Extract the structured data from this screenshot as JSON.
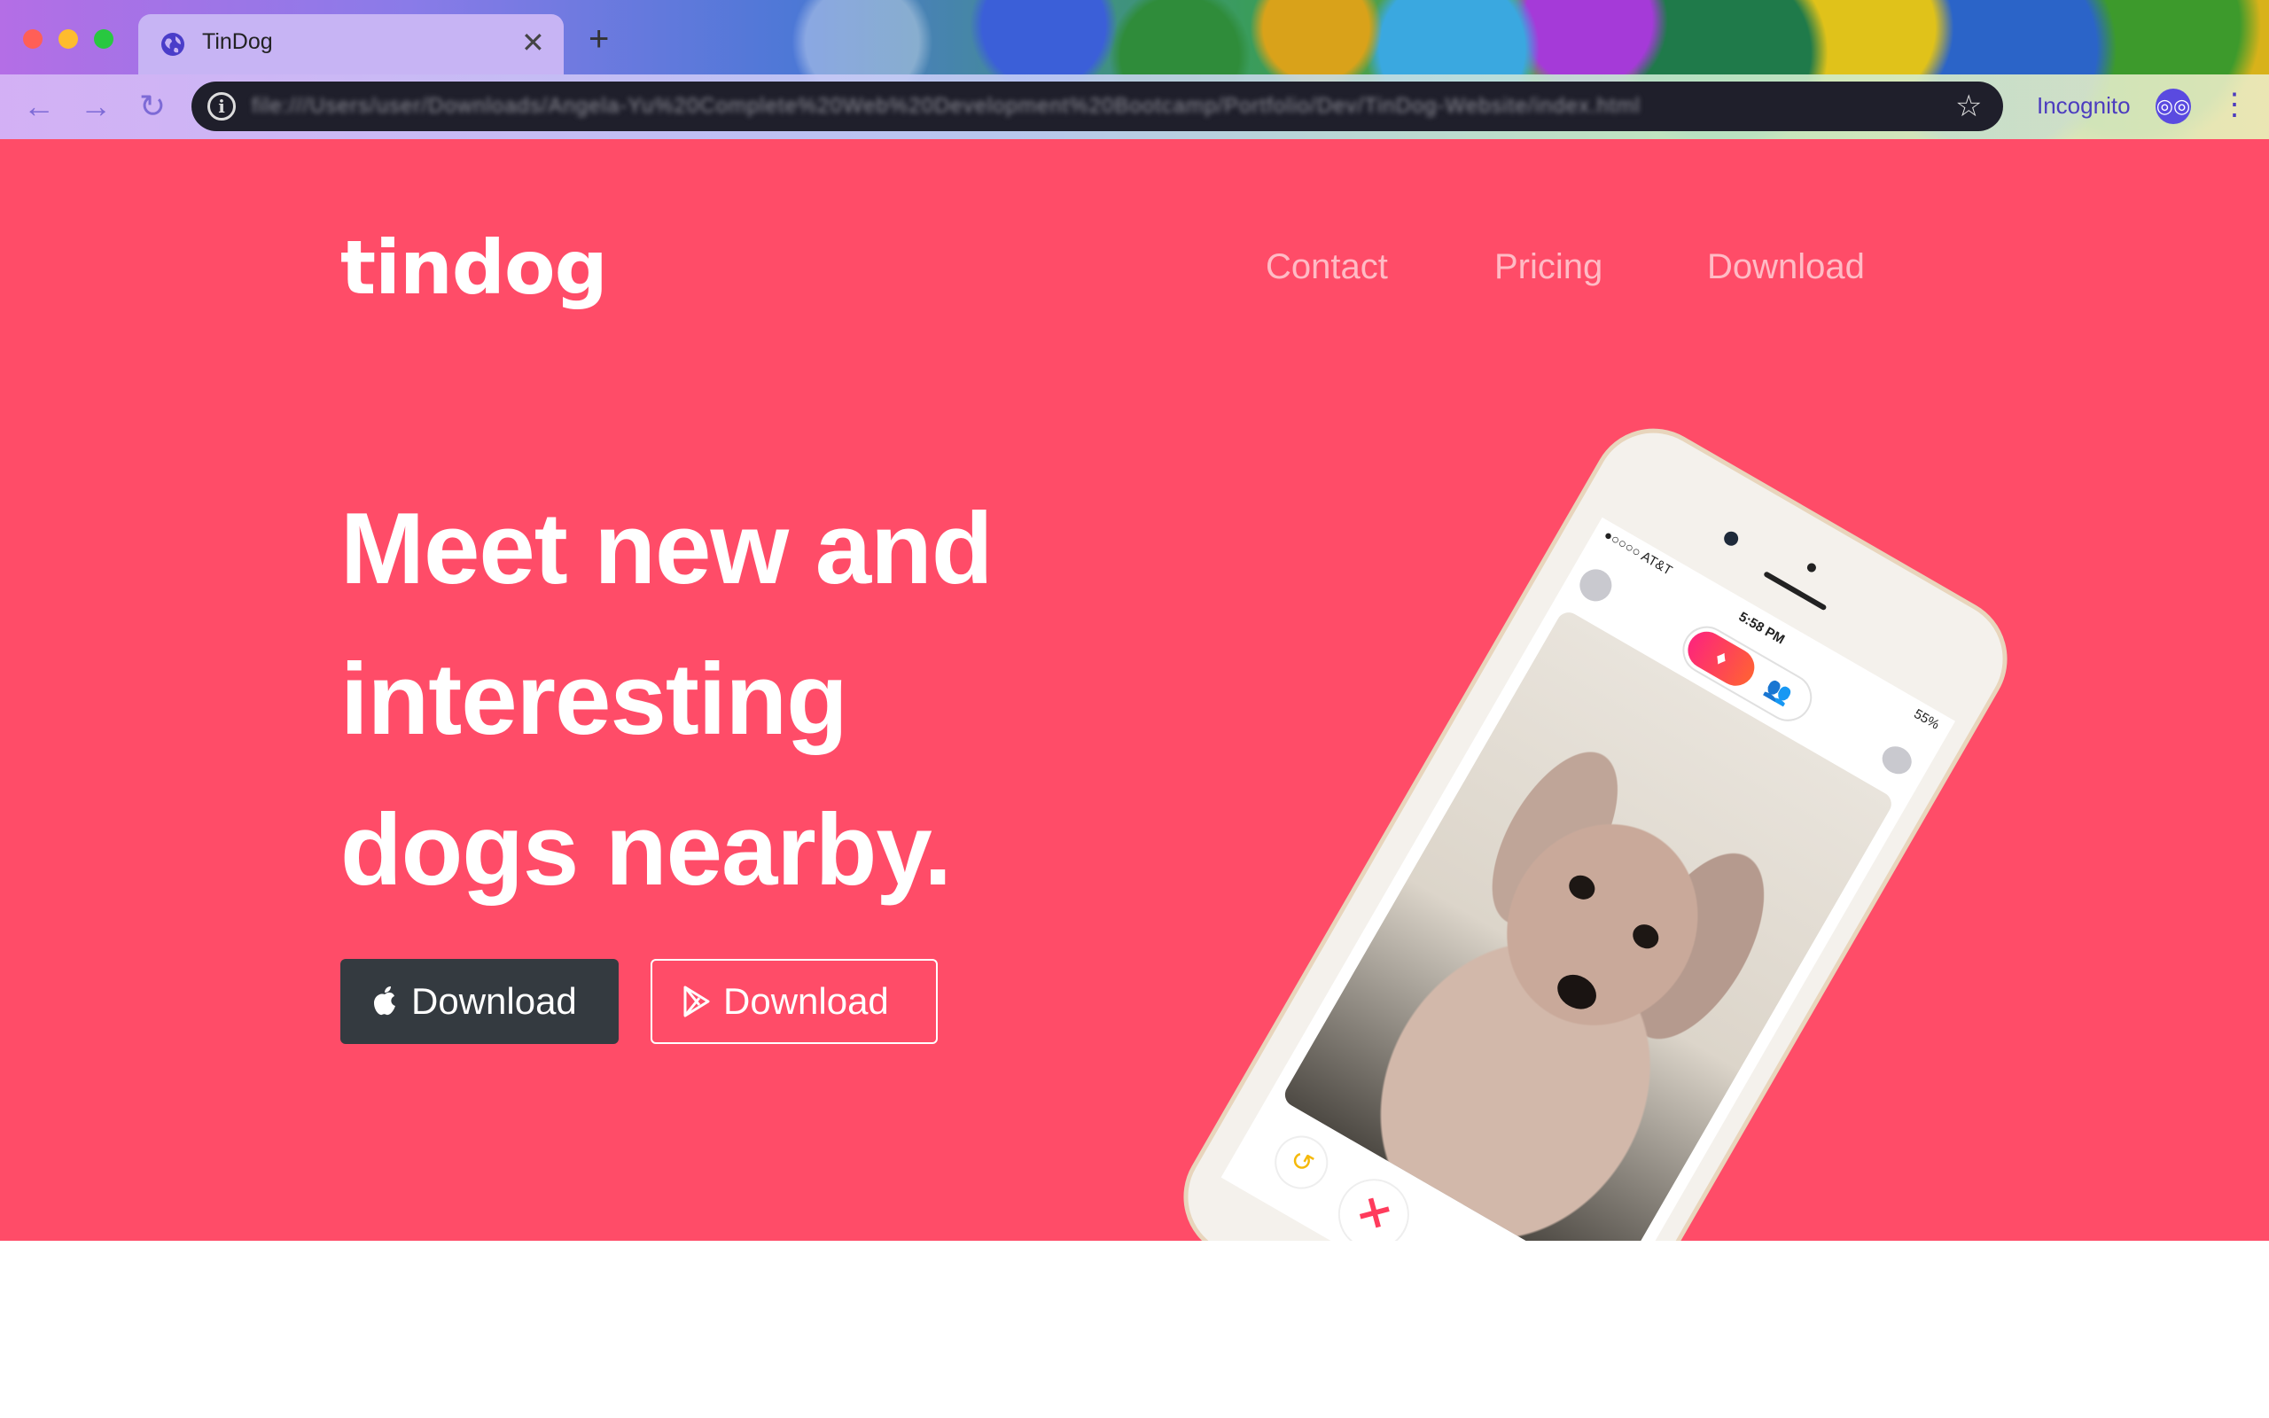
{
  "browser": {
    "tab_title": "TinDog",
    "tab_close": "✕",
    "new_tab": "+",
    "nav": {
      "back": "←",
      "forward": "→",
      "reload": "↻"
    },
    "info_icon": "i",
    "url": "file:///Users/user/Downloads/Angela-Yu%20Complete%20Web%20Development%20Bootcamp/Portfolio/Dev/TinDog-Website/index.html",
    "star_icon": "☆",
    "incognito_label": "Incognito",
    "incognito_icon": "◎◎",
    "menu_icon": "⋮"
  },
  "page": {
    "brand": "tindog",
    "nav": {
      "contact": "Contact",
      "pricing": "Pricing",
      "download": "Download"
    },
    "headline": [
      "Meet new and",
      "interesting",
      "dogs nearby."
    ],
    "buttons": {
      "apple_download": "Download",
      "google_download": "Download"
    },
    "colors": {
      "hero_bg": "#ff4c68",
      "dark_button": "#343a40",
      "accent": "#ffffff"
    }
  },
  "phone": {
    "carrier": "●○○○○ AT&T",
    "time": "5:58 PM",
    "battery": "55%",
    "toggle_icon": "♦",
    "toggle_off_icon": "👥",
    "rewind_icon": "↺",
    "nope_icon": "✕"
  }
}
